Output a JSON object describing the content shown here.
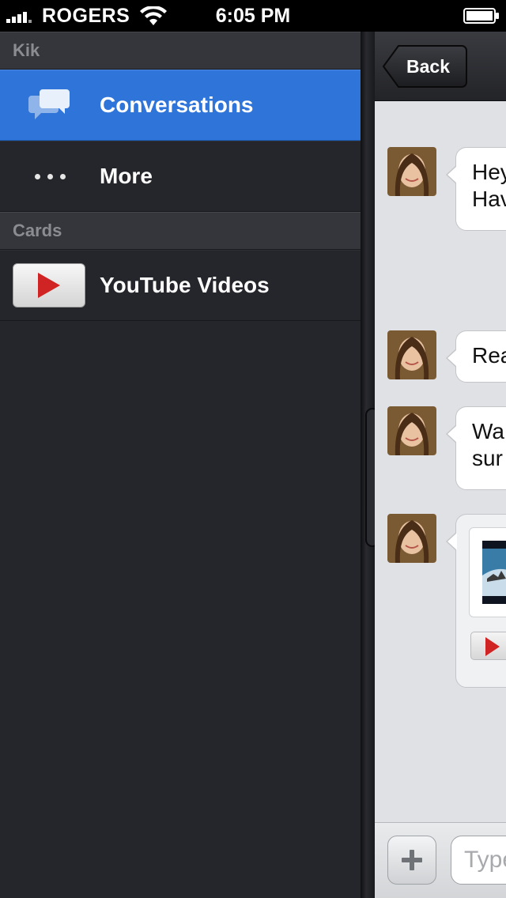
{
  "status_bar": {
    "carrier": "ROGERS",
    "time": "6:05 PM",
    "signal_bars": 4
  },
  "sidebar": {
    "app_section": "Kik",
    "items": [
      {
        "label": "Conversations",
        "icon": "speech-bubbles-icon",
        "active": true
      },
      {
        "label": "More",
        "icon": "ellipsis-icon",
        "active": false
      }
    ],
    "cards_section": "Cards",
    "cards": [
      {
        "label": "YouTube Videos",
        "icon": "youtube-play-icon"
      }
    ]
  },
  "chat": {
    "back_label": "Back",
    "messages": [
      {
        "text_line1": "Hey",
        "text_line2": "Hav"
      },
      {
        "text_line1": "Rea"
      },
      {
        "text_line1": "Wa",
        "text_line2": "sur"
      }
    ],
    "input_placeholder": "Type"
  },
  "colors": {
    "accent": "#2f74d9",
    "sidebar_bg": "#25262b",
    "chat_bg": "#dfe1e5",
    "youtube_red": "#d02424"
  }
}
